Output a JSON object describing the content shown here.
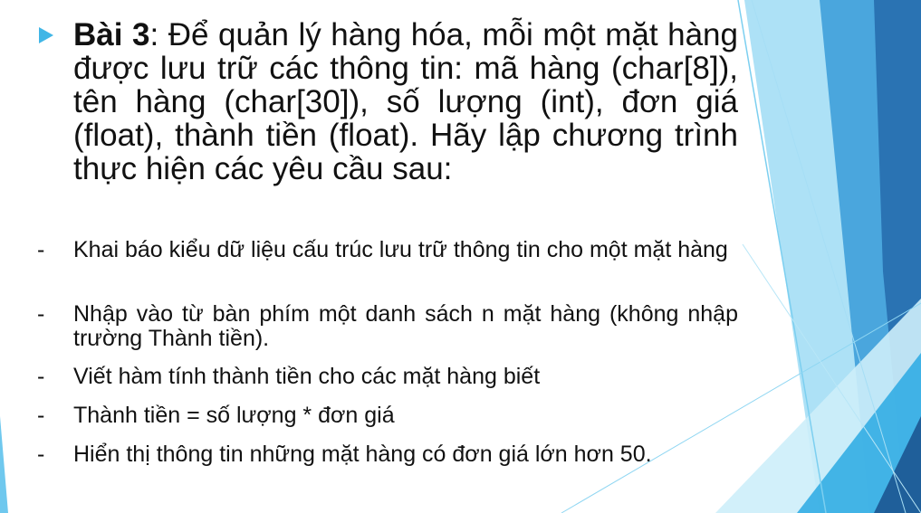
{
  "heading": {
    "label": "Bài 3",
    "text": ": Để quản lý hàng hóa, mỗi một mặt hàng được lưu trữ các thông tin: mã hàng (char[8]), tên hàng (char[30]), số lượng (int), đơn giá (float), thành tiền (float). Hãy lập chương trình thực hiện các yêu cầu sau:"
  },
  "items": [
    {
      "marker": "-",
      "text": "Khai báo kiểu dữ liệu cấu trúc lưu trữ thông tin cho một mặt hàng"
    },
    {
      "marker": "-",
      "text": "Nhập vào từ bàn phím một danh sách n mặt hàng (không nhập trường Thành tiền)."
    },
    {
      "marker": "-",
      "text": "Viết hàm tính thành tiền cho các mặt hàng biết"
    },
    {
      "marker": "-",
      "text": "Thành tiền = số lượng * đơn giá"
    },
    {
      "marker": "-",
      "text": "Hiển thị thông tin những mặt hàng có đơn giá lớn hơn 50."
    }
  ],
  "colors": {
    "bullet": "#41b6e6",
    "text": "#111111",
    "facet_dark": "#1f5f9a",
    "facet_mid": "#2f86c6",
    "facet_light": "#5cc6ef"
  }
}
